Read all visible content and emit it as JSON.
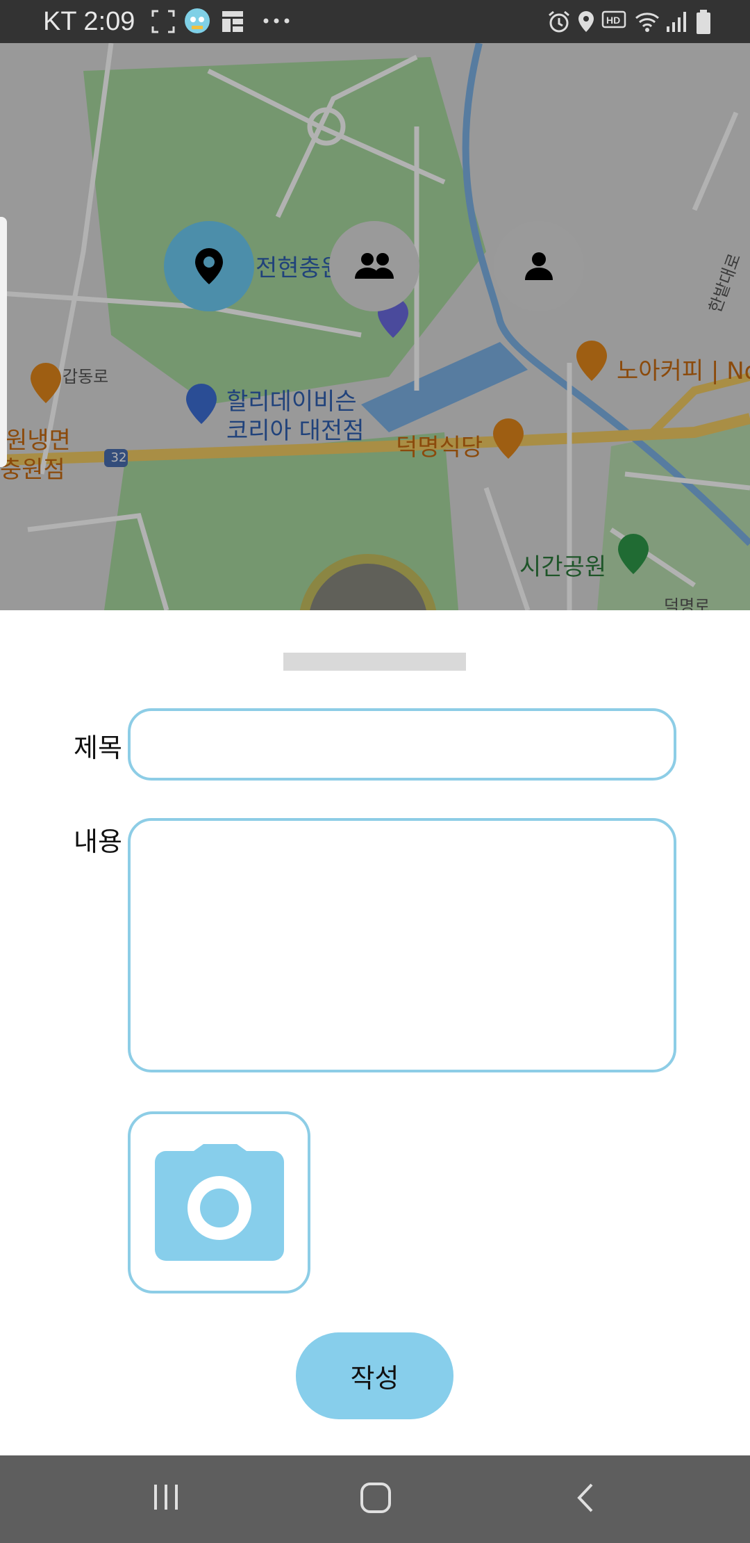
{
  "status_bar": {
    "carrier_time": "KT 2:09",
    "left_icons": [
      "screenshot-icon",
      "app-avatar-icon",
      "gallery-icon",
      "more-dots-icon"
    ],
    "right_icons": [
      "alarm-icon",
      "location-icon",
      "hd-icon",
      "wifi-icon",
      "signal-icon",
      "battery-icon"
    ]
  },
  "map": {
    "labels": {
      "jeonhyeon": "전현충원",
      "gapdong": "갑동로",
      "holiday": "할리데이비슨",
      "holiday2": "코리아 대전점",
      "naengmyeon": "원냉면",
      "naengmyeon2": "충원점",
      "deokmyeong": "덕명식당",
      "noa": "노아커피 | No",
      "sigan": "시간공원",
      "hanbat": "한밭대로",
      "deokmyeongro": "덕명로",
      "route": "32"
    },
    "fabs": {
      "active": "location-pin-icon",
      "group": "group-icon",
      "person": "person-icon"
    }
  },
  "form": {
    "title_label": "제목",
    "title_value": "",
    "content_label": "내용",
    "content_value": "",
    "submit_label": "작성"
  },
  "colors": {
    "accent": "#87ceeb",
    "border": "#8dcde6",
    "active_fab": "#4c8eaa"
  }
}
